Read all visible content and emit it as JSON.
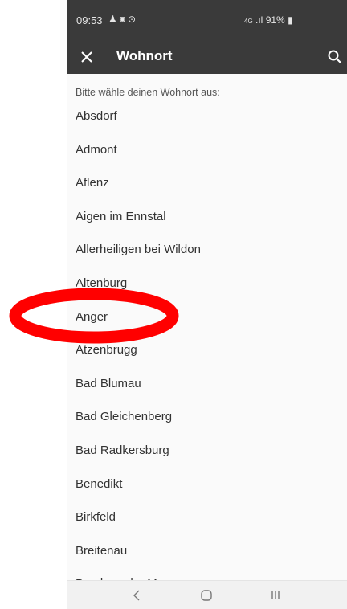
{
  "status_bar": {
    "time": "09:53",
    "notification_icons": [
      "person-icon",
      "instagram-icon",
      "clock-icon"
    ],
    "network": "4G",
    "battery": "91%"
  },
  "app_bar": {
    "title": "Wohnort",
    "close_icon": "close-icon",
    "search_icon": "search-icon"
  },
  "content": {
    "prompt": "Bitte wähle deinen Wohnort aus:",
    "places": [
      "Absdorf",
      "Admont",
      "Aflenz",
      "Aigen im Ennstal",
      "Allerheiligen bei Wildon",
      "Altenburg",
      "Anger",
      "Atzenbrugg",
      "Bad Blumau",
      "Bad Gleichenberg",
      "Bad Radkersburg",
      "Benedikt",
      "Birkfeld",
      "Breitenau",
      "Bruck an der Mur"
    ]
  },
  "nav_bar": {
    "back_icon": "back-chevron-icon",
    "home_icon": "home-icon",
    "recents_icon": "recents-icon"
  },
  "colors": {
    "app_bar": "#3a3a3a",
    "background": "#fafafa",
    "annotation": "#ff0000"
  }
}
